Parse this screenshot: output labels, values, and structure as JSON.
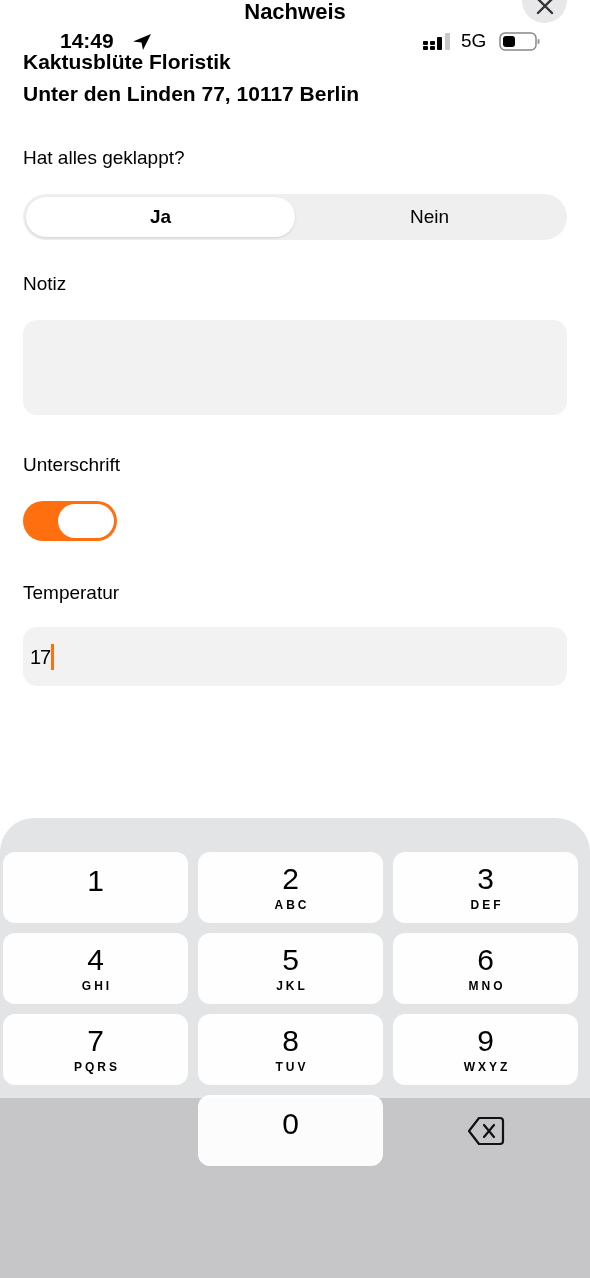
{
  "status_bar": {
    "time": "14:49",
    "network": "5G"
  },
  "header": {
    "title": "Nachweis"
  },
  "address": {
    "name": "Kaktusblüte Floristik",
    "street": "Unter den Linden 77, 10117 Berlin"
  },
  "form": {
    "success": {
      "label": "Hat alles geklappt?",
      "options": [
        {
          "label": "Ja",
          "selected": true
        },
        {
          "label": "Nein",
          "selected": false
        }
      ]
    },
    "note": {
      "label": "Notiz"
    },
    "signature": {
      "label": "Unterschrift",
      "on": true
    },
    "temperature": {
      "label": "Temperatur",
      "value": "17",
      "focused": true
    }
  },
  "keyboard": {
    "keys": [
      {
        "kind": "digit",
        "digit": "1"
      },
      {
        "kind": "digit",
        "digit": "2",
        "letters": "ABC"
      },
      {
        "kind": "digit",
        "digit": "3",
        "letters": "DEF"
      },
      {
        "kind": "digit",
        "digit": "4",
        "letters": "GHI"
      },
      {
        "kind": "digit",
        "digit": "5",
        "letters": "JKL"
      },
      {
        "kind": "digit",
        "digit": "6",
        "letters": "MNO"
      },
      {
        "kind": "digit",
        "digit": "7",
        "letters": "PQRS"
      },
      {
        "kind": "digit",
        "digit": "8",
        "letters": "TUV"
      },
      {
        "kind": "digit",
        "digit": "9",
        "letters": "WXYZ"
      },
      {
        "kind": "blank"
      },
      {
        "kind": "digit",
        "digit": "0"
      },
      {
        "kind": "delete"
      }
    ]
  }
}
